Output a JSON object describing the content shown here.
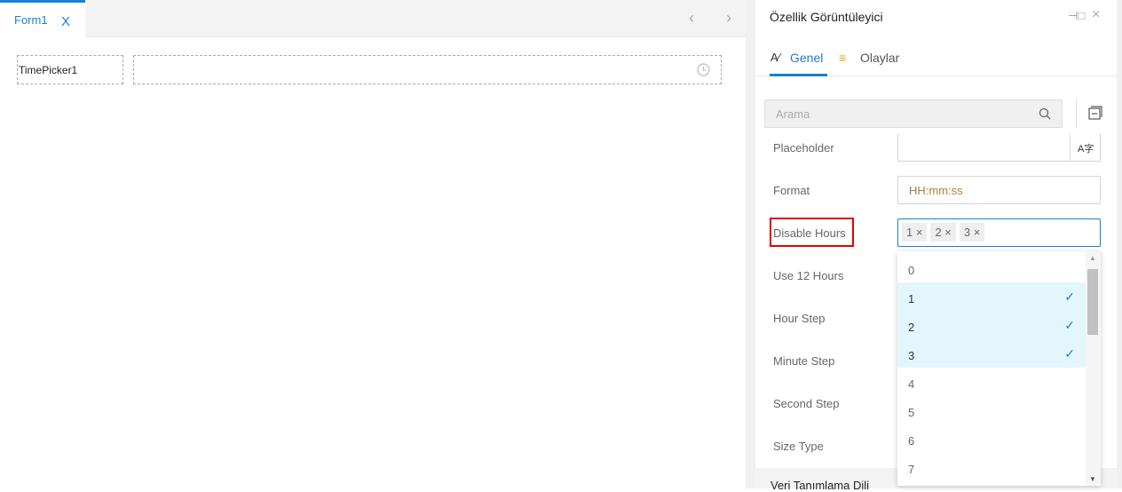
{
  "designer": {
    "tab_label": "Form1",
    "tab_close": "X",
    "nav_prev": "‹",
    "nav_next": "›",
    "label_text": "TimePicker1"
  },
  "panel": {
    "title": "Özellik Görüntüleyici",
    "tabs": [
      {
        "label": "Genel"
      },
      {
        "label": "Olaylar"
      }
    ],
    "search_placeholder": "Arama",
    "properties": [
      {
        "label": "Placeholder",
        "value": ""
      },
      {
        "label": "Format",
        "value": "HH:mm:ss"
      },
      {
        "label": "Disable Hours",
        "chips": [
          "1",
          "2",
          "3"
        ]
      },
      {
        "label": "Use 12 Hours"
      },
      {
        "label": "Hour Step"
      },
      {
        "label": "Minute Step"
      },
      {
        "label": "Second Step"
      },
      {
        "label": "Size Type"
      }
    ],
    "section": "Veri Tanımlama Dili"
  },
  "dropdown": {
    "options": [
      {
        "v": "0",
        "sel": false
      },
      {
        "v": "1",
        "sel": true
      },
      {
        "v": "2",
        "sel": true
      },
      {
        "v": "3",
        "sel": true
      },
      {
        "v": "4",
        "sel": false
      },
      {
        "v": "5",
        "sel": false
      },
      {
        "v": "6",
        "sel": false
      },
      {
        "v": "7",
        "sel": false
      }
    ],
    "check": "✓"
  },
  "colors": {
    "accent": "#1a7fd4",
    "highlight": "#e3f6fd",
    "red": "#e00000"
  }
}
